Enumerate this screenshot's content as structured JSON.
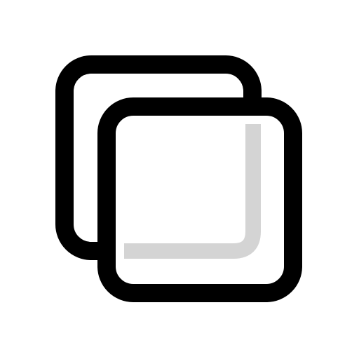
{
  "icon": {
    "name": "copy-windows-icon",
    "colors": {
      "background": "#ffffff",
      "outline": "#000000",
      "fill": "#ffffff",
      "inner_shadow": "#d4d4d4"
    }
  }
}
